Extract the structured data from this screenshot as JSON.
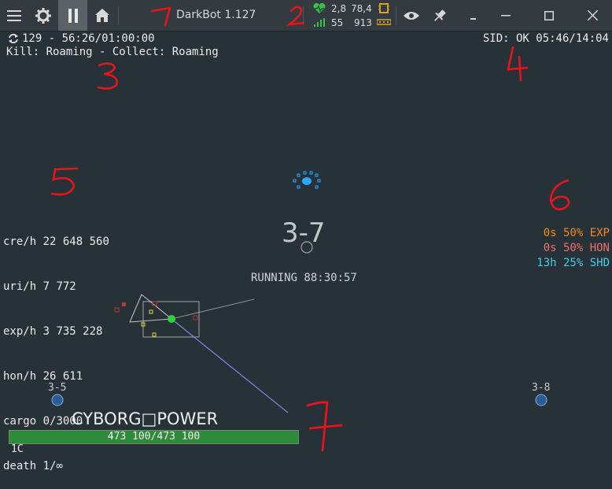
{
  "app": {
    "title": "DarkBot 1.127",
    "stats": {
      "cpu_a": "2,8",
      "cpu_b": "78,4",
      "ping": "55",
      "memory": "913"
    }
  },
  "hud": {
    "status_line": "129 - 56:26/01:00:00",
    "mode_line": "Kill: Roaming - Collect: Roaming",
    "sid_line": "SID: OK 05:46/14:04",
    "stats": [
      {
        "label": "cre/h",
        "value": "22 648 560"
      },
      {
        "label": "uri/h",
        "value": "7 772"
      },
      {
        "label": "exp/h",
        "value": "3 735 228"
      },
      {
        "label": "hon/h",
        "value": "26 611"
      },
      {
        "label": "cargo",
        "value": "0/3000"
      },
      {
        "label": "death",
        "value": "1/∞"
      }
    ],
    "map_name": "3-7",
    "state": "RUNNING 88:30:57",
    "buffs": [
      {
        "text": "0s 50% EXP",
        "color": "#ef8a22"
      },
      {
        "text": "0s 50% HON",
        "color": "#ef6f6f"
      },
      {
        "text": "13h 25% SHD",
        "color": "#45cde6"
      }
    ],
    "portals": [
      {
        "name": "3-5"
      },
      {
        "name": "3-8"
      }
    ],
    "ship_name": "CYBORG□POWER",
    "health": "473 100/473 100",
    "group": "1C"
  },
  "annotations": [
    "1",
    "2",
    "3",
    "4",
    "5",
    "6",
    "7"
  ],
  "colors": {
    "background": "#273138",
    "titlebar": "#333a40",
    "health": "#2e8b3a",
    "annotation": "#e8141b",
    "accent_blue": "#2aa8ff"
  }
}
